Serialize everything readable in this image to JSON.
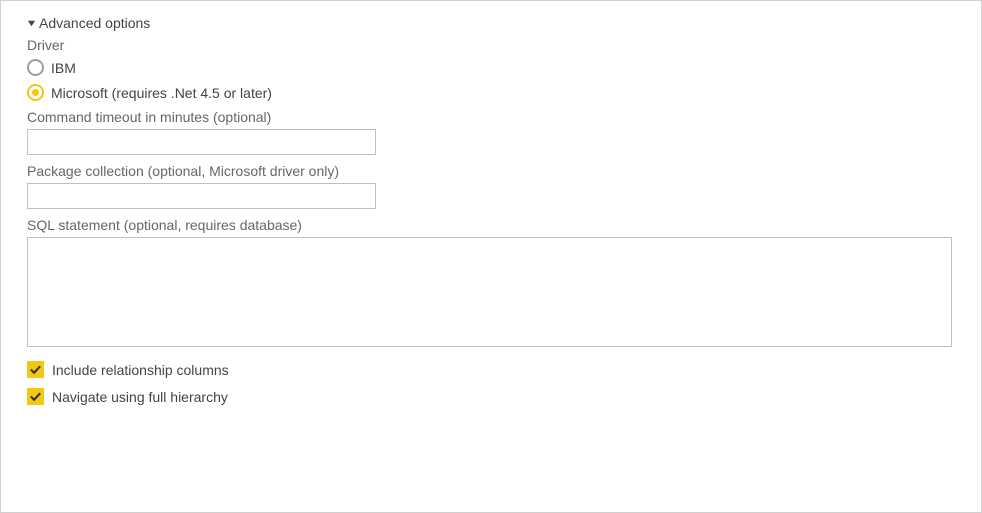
{
  "advanced": {
    "header": "Advanced options",
    "expanded": true,
    "driver": {
      "label": "Driver",
      "options": [
        {
          "label": "IBM",
          "selected": false
        },
        {
          "label": "Microsoft (requires .Net 4.5 or later)",
          "selected": true
        }
      ]
    },
    "command_timeout": {
      "label": "Command timeout in minutes (optional)",
      "value": ""
    },
    "package_collection": {
      "label": "Package collection (optional, Microsoft driver only)",
      "value": ""
    },
    "sql_statement": {
      "label": "SQL statement (optional, requires database)",
      "value": ""
    },
    "include_relationship_columns": {
      "label": "Include relationship columns",
      "checked": true
    },
    "navigate_full_hierarchy": {
      "label": "Navigate using full hierarchy",
      "checked": true
    }
  }
}
